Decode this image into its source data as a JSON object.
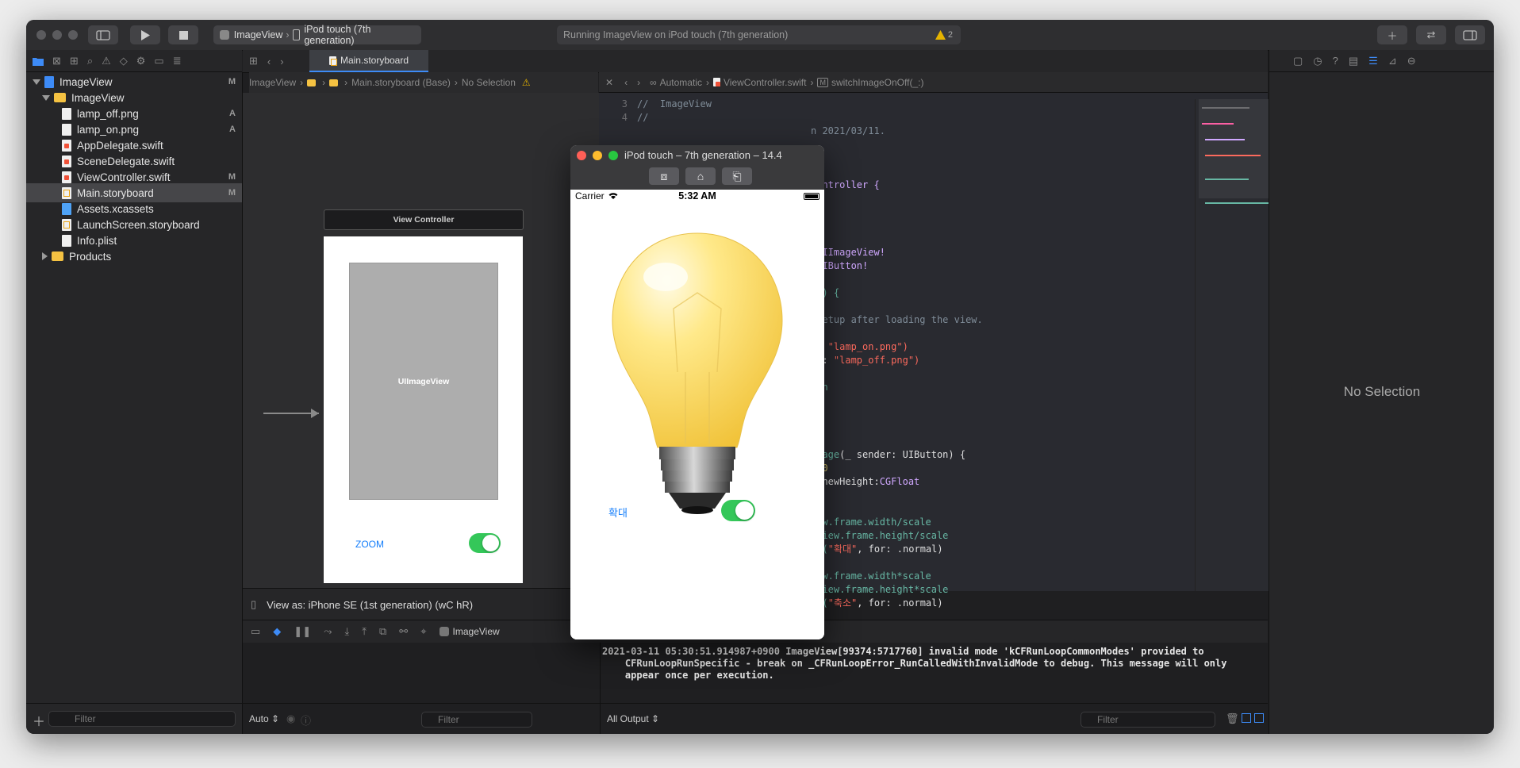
{
  "toolbar": {
    "scheme_target": "ImageView",
    "scheme_device": "iPod touch (7th generation)",
    "status_text": "Running ImageView on iPod touch (7th generation)",
    "warning_count": "2"
  },
  "navigator": {
    "items": [
      {
        "label": "ImageView",
        "badge": "M"
      },
      {
        "label": "ImageView",
        "badge": ""
      },
      {
        "label": "lamp_off.png",
        "badge": "A"
      },
      {
        "label": "lamp_on.png",
        "badge": "A"
      },
      {
        "label": "AppDelegate.swift",
        "badge": ""
      },
      {
        "label": "SceneDelegate.swift",
        "badge": ""
      },
      {
        "label": "ViewController.swift",
        "badge": "M"
      },
      {
        "label": "Main.storyboard",
        "badge": "M"
      },
      {
        "label": "Assets.xcassets",
        "badge": ""
      },
      {
        "label": "LaunchScreen.storyboard",
        "badge": ""
      },
      {
        "label": "Info.plist",
        "badge": ""
      },
      {
        "label": "Products",
        "badge": ""
      }
    ],
    "filter_placeholder": "Filter"
  },
  "tab": {
    "label": "Main.storyboard"
  },
  "ib_breadcrumb": {
    "p1": "ImageView",
    "p2": "Main.storyboard (Base)",
    "p3": "No Selection"
  },
  "editor_breadcrumb": {
    "p1": "Automatic",
    "p2": "ViewController.swift",
    "p3": "M",
    "p4": "switchImageOnOff(_:)"
  },
  "storyboard": {
    "scene_title": "View Controller",
    "image_label": "UIImageView",
    "zoom_label": "ZOOM",
    "view_as": "View as: iPhone SE (1st generation) (wC hR)"
  },
  "simulator": {
    "title": "iPod touch – 7th generation – 14.4",
    "carrier": "Carrier",
    "time": "5:32 AM",
    "button_label": "확대"
  },
  "code": {
    "l3n": "3",
    "l3": "//  ImageView",
    "l4n": "4",
    "l4": "//",
    "date": "n 2021/03/11.",
    "ctrl": "Controller {",
    "uiimageview": "UIImageView!",
    "uibutton": "UIButton!",
    "didload": "d() {",
    "setup": "setup after loading the view.",
    "on_prefix": "d: ",
    "on_str": "\"lamp_on.png\")",
    "off_prefix": "ed: ",
    "off_str": "\"lamp_off.png\")",
    "gon": "gOn",
    "image_fn": "image",
    "image_args": "(_ sender: UIButton) {",
    "scale": "2.0",
    "newheight": ", newHeight:",
    "cgfloat": "CGFloat",
    "w1": "iew.frame.width/scale",
    "h1": "eView.frame.height/scale",
    "t1a": "le(",
    "t1b": "\"확대\"",
    "t1c": ", for: .normal)",
    "w2": "iew.frame.width*scale",
    "h2": "eView.frame.height*scale",
    "t2a": "le(",
    "t2b": "\"축소\"",
    "t2c": ", for: .normal)"
  },
  "debug": {
    "target": "ImageView"
  },
  "console": {
    "line1": "2021-03-11 05:30:51.914987+0900 ImageView[99374:5717760] invalid mode 'kCFRunLoopCommonModes' provided to",
    "line2": "    CFRunLoopRunSpecific - break on _CFRunLoopError_RunCalledWithInvalidMode to debug. This message will only",
    "line3": "    appear once per execution."
  },
  "bottom": {
    "auto_label": "Auto ⇕",
    "filter_placeholder": "Filter",
    "all_output": "All Output ⇕"
  },
  "inspector": {
    "empty_label": "No Selection"
  },
  "colors": {
    "accent": "#34c759",
    "selection": "#464649",
    "link": "#147efb"
  }
}
